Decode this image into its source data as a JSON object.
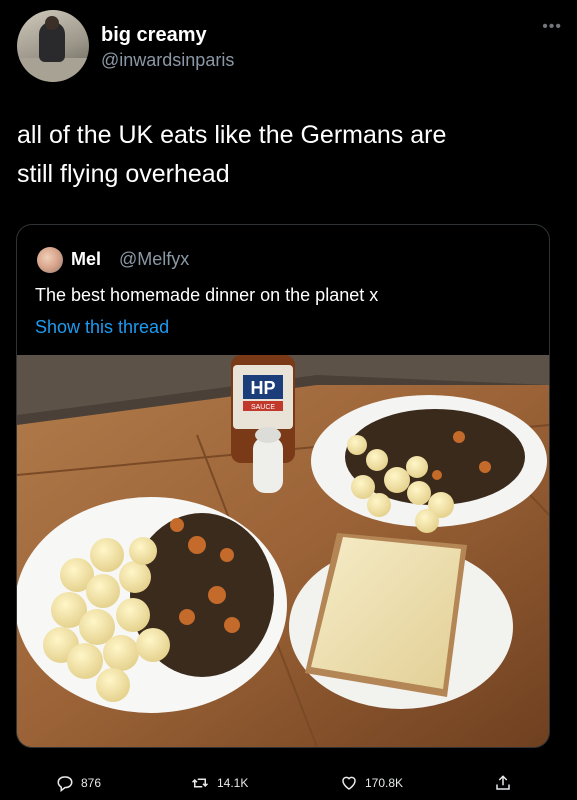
{
  "author": {
    "name": "big creamy",
    "handle": "@inwardsinparis",
    "more_icon": "more-dots-icon"
  },
  "tweet": {
    "text_line1": "all of the UK eats like the Germans are",
    "text_line2": "still flying overhead"
  },
  "quoted": {
    "name": "Mel",
    "handle": "@Melfyx",
    "text": "The best homemade dinner on the planet x",
    "show_thread": "Show this thread",
    "photo": {
      "bottle_label": "HP",
      "bottle_sub": "SAUCE"
    }
  },
  "actions": {
    "replies": "876",
    "retweets": "14.1K",
    "likes": "170.8K"
  },
  "colors": {
    "background": "#000000",
    "text": "#e7e9ea",
    "secondary": "#8b98a5",
    "link": "#1d9bf0"
  }
}
